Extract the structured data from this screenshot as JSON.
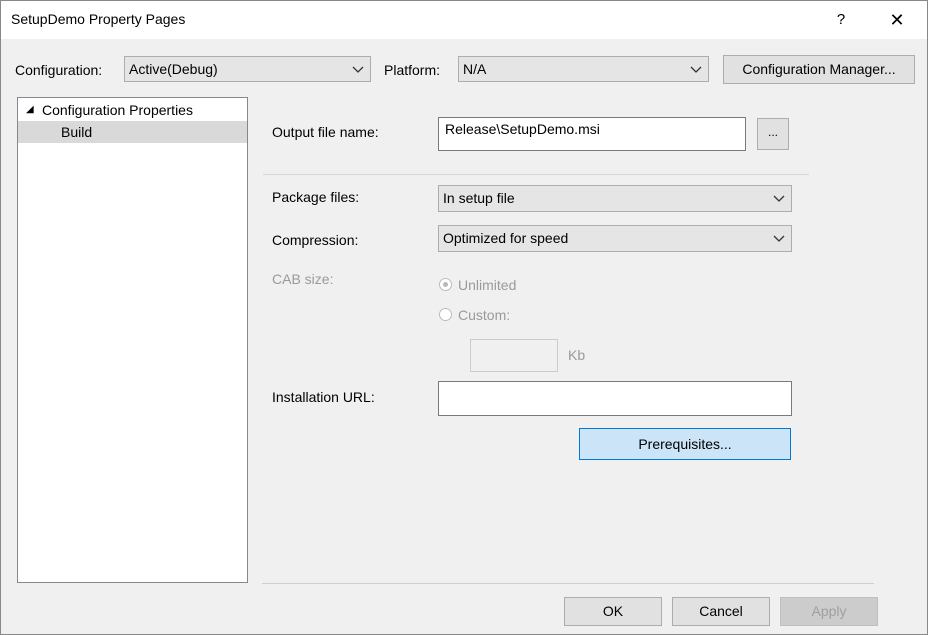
{
  "window": {
    "title": "SetupDemo Property Pages",
    "help_glyph": "?",
    "close_glyph": "✕"
  },
  "toolbar": {
    "configuration_label": "Configuration:",
    "configuration_value": "Active(Debug)",
    "platform_label": "Platform:",
    "platform_value": "N/A",
    "config_manager_label": "Configuration Manager..."
  },
  "tree": {
    "root_expander": "◢",
    "root_label": "Configuration Properties",
    "child_label": "Build"
  },
  "build": {
    "output_label": "Output file name:",
    "output_value": "Release\\SetupDemo.msi",
    "browse_label": "...",
    "package_label": "Package files:",
    "package_value": "In setup file",
    "compression_label": "Compression:",
    "compression_value": "Optimized for speed",
    "cab_label": "CAB size:",
    "unlimited_label": "Unlimited",
    "custom_label": "Custom:",
    "custom_value": "",
    "kb_label": "Kb",
    "install_url_label": "Installation URL:",
    "install_url_value": "",
    "prereq_label": "Prerequisites..."
  },
  "footer": {
    "ok_label": "OK",
    "cancel_label": "Cancel",
    "apply_label": "Apply"
  }
}
